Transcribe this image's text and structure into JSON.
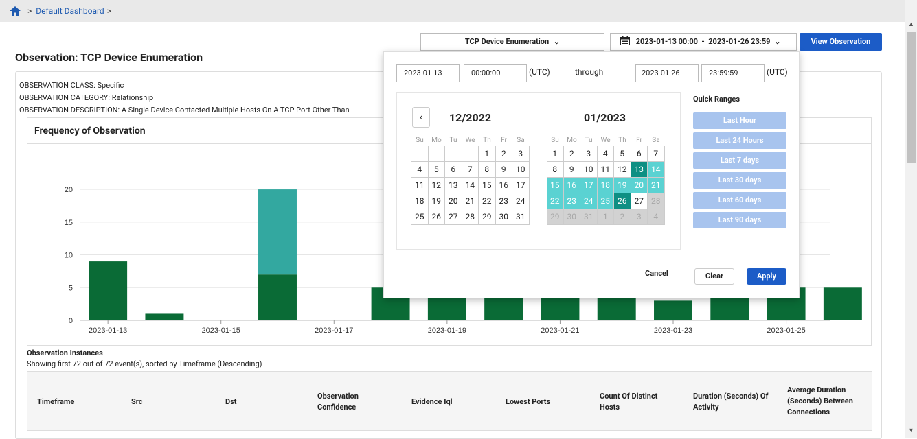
{
  "breadcrumb": {
    "home_icon": "home-icon",
    "separator": ">",
    "item": "Default Dashboard",
    "trailing_separator": ">"
  },
  "toolbar": {
    "observation_select": "TCP Device Enumeration",
    "date_range": "2023-01-13 00:00  -  2023-01-26 23:59",
    "view_button": "View Observation"
  },
  "page_title": "Observation: TCP Device Enumeration",
  "meta": {
    "class": "OBSERVATION CLASS: Specific",
    "category": "OBSERVATION CATEGORY: Relationship",
    "description": "OBSERVATION DESCRIPTION: A Single Device Contacted Multiple Hosts On A TCP Port Other Than"
  },
  "chart_title": "Frequency of Observation",
  "chart_data": {
    "type": "bar",
    "stacked": true,
    "x": [
      "2023-01-13",
      "2023-01-14",
      "2023-01-15",
      "2023-01-16",
      "2023-01-17",
      "2023-01-18",
      "2023-01-19",
      "2023-01-20",
      "2023-01-21",
      "2023-01-22",
      "2023-01-23",
      "2023-01-24",
      "2023-01-25",
      "2023-01-26"
    ],
    "x_tick_labels": [
      "2023-01-13",
      "2023-01-15",
      "2023-01-17",
      "2023-01-19",
      "2023-01-21",
      "2023-01-23",
      "2023-01-25"
    ],
    "series": [
      {
        "color": "#0a6b36",
        "values": [
          9,
          1,
          0,
          7,
          0,
          5,
          5,
          5,
          5,
          5,
          3,
          5,
          5,
          5
        ]
      },
      {
        "color": "#33a8a0",
        "values": [
          0,
          0,
          0,
          13,
          0,
          0,
          0,
          0,
          0,
          0,
          0,
          0,
          0,
          0
        ]
      }
    ],
    "y_ticks": [
      0,
      5,
      10,
      15,
      20
    ],
    "ylim": [
      0,
      22
    ],
    "grid": true
  },
  "instances": {
    "title": "Observation Instances",
    "subtitle": "Showing first 72 out of 72 event(s), sorted by Timeframe (Descending)",
    "columns": [
      "Timeframe",
      "Src",
      "Dst",
      "Observation Confidence",
      "Evidence Iql",
      "Lowest Ports",
      "Count Of Distinct Hosts",
      "Duration (Seconds) Of Activity",
      "Average Duration (Seconds) Between Connections"
    ]
  },
  "picker": {
    "start_date": "2023-01-13",
    "start_time": "00:00:00",
    "tz1": "(UTC)",
    "through": "through",
    "end_date": "2023-01-26",
    "end_time": "23:59:59",
    "tz2": "(UTC)",
    "prev": "‹",
    "left_month": "12/2022",
    "right_month": "01/2023",
    "dow": [
      "Su",
      "Mo",
      "Tu",
      "We",
      "Th",
      "Fr",
      "Sa"
    ],
    "quick_title": "Quick Ranges",
    "quick": [
      "Last Hour",
      "Last 24 Hours",
      "Last 7 days",
      "Last 30 days",
      "Last 60 days",
      "Last 90 days"
    ],
    "cancel": "Cancel",
    "clear": "Clear",
    "apply": "Apply"
  }
}
